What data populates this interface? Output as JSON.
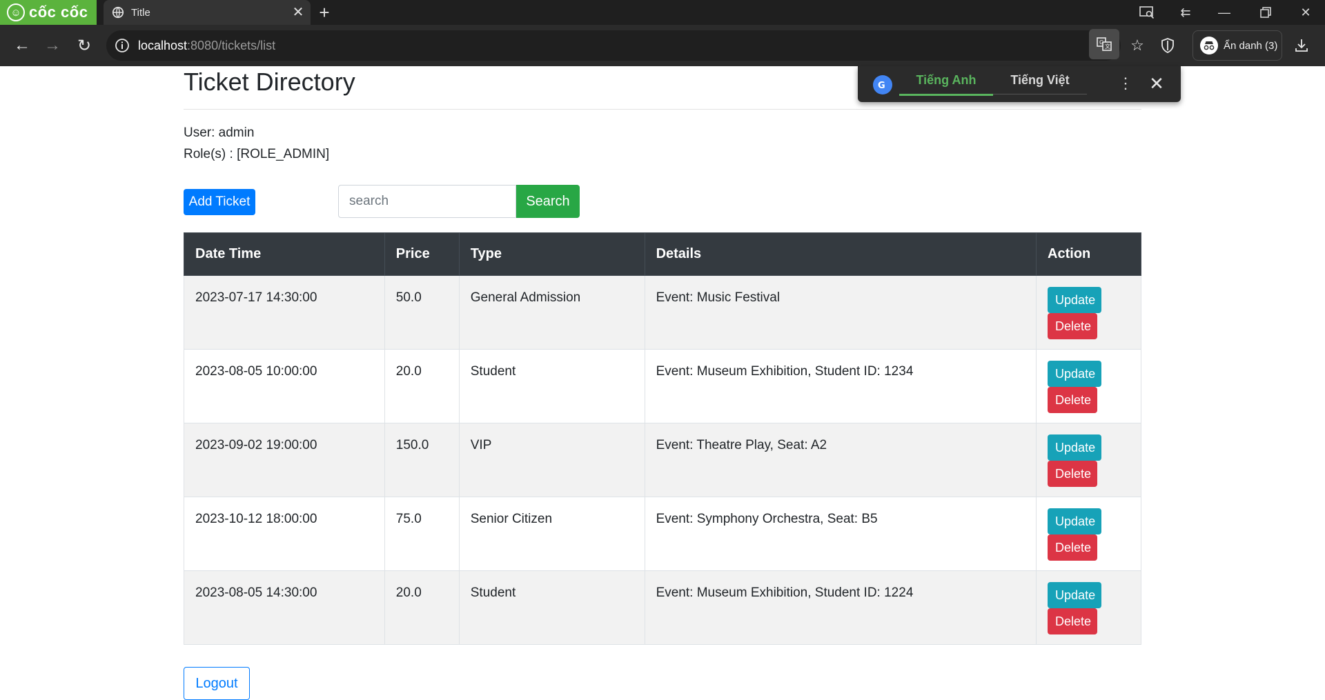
{
  "browser": {
    "brand": "cốc cốc",
    "tab_title": "Title",
    "url_host": "localhost",
    "url_rest": ":8080/tickets/list",
    "incognito_label": "Ẩn danh (3)"
  },
  "translate": {
    "lang_source": "Tiếng Anh",
    "lang_target": "Tiếng Việt"
  },
  "page": {
    "title": "Ticket Directory",
    "user_line": "User: admin",
    "role_line": "Role(s) : [ROLE_ADMIN]",
    "add_button": "Add Ticket",
    "search_placeholder": "search",
    "search_button": "Search",
    "logout_button": "Logout"
  },
  "table": {
    "headers": [
      "Date Time",
      "Price",
      "Type",
      "Details",
      "Action"
    ],
    "update_label": "Update",
    "delete_label": "Delete",
    "rows": [
      {
        "datetime": "2023-07-17 14:30:00",
        "price": "50.0",
        "type": "General Admission",
        "details": "Event: Music Festival"
      },
      {
        "datetime": "2023-08-05 10:00:00",
        "price": "20.0",
        "type": "Student",
        "details": "Event: Museum Exhibition, Student ID: 1234"
      },
      {
        "datetime": "2023-09-02 19:00:00",
        "price": "150.0",
        "type": "VIP",
        "details": "Event: Theatre Play, Seat: A2"
      },
      {
        "datetime": "2023-10-12 18:00:00",
        "price": "75.0",
        "type": "Senior Citizen",
        "details": "Event: Symphony Orchestra, Seat: B5"
      },
      {
        "datetime": "2023-08-05 14:30:00",
        "price": "20.0",
        "type": "Student",
        "details": "Event: Museum Exhibition, Student ID: 1224"
      }
    ]
  }
}
